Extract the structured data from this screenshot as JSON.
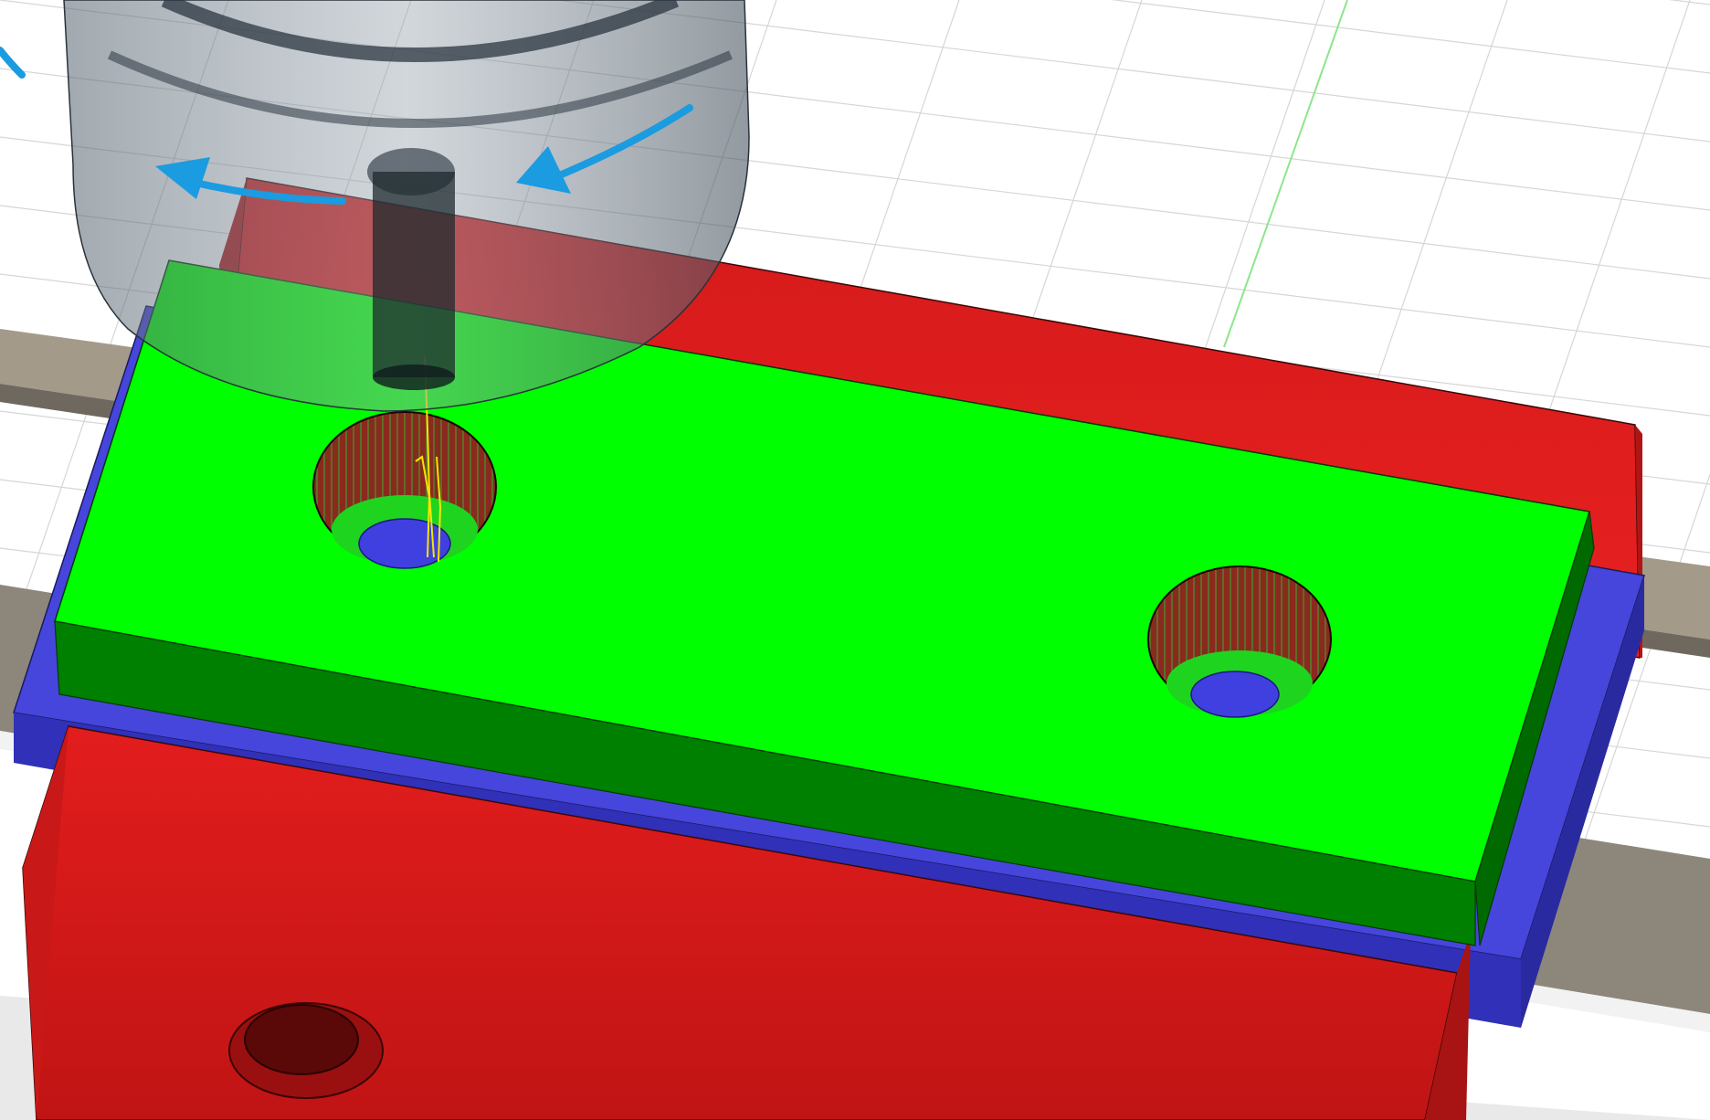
{
  "app": {
    "view": "cam-simulation-viewport",
    "canvas_label": ""
  },
  "scene": {
    "background_color": "#ffffff",
    "grid_line_color": "#d6d6d6",
    "grid_axis_color": "#8ee58e",
    "stock_top_color": "#00ff00",
    "stock_side_color": "#008000",
    "fixture_plate_color": "#4848e0",
    "vise_jaw_color": "#e81c1c",
    "vise_rail_color": "#8a8478",
    "tool_holder_color": "#7f8b96",
    "tool_shank_color": "#1f2b30",
    "rotation_arrow_color": "#1b9be0",
    "toolpath_color": "#f3e600",
    "holes": [
      {
        "id": "hole-1",
        "state": "in-progress"
      },
      {
        "id": "hole-2",
        "state": "complete"
      }
    ],
    "icons": {
      "spindle_rotation": "rotation-arrow-icon"
    }
  }
}
